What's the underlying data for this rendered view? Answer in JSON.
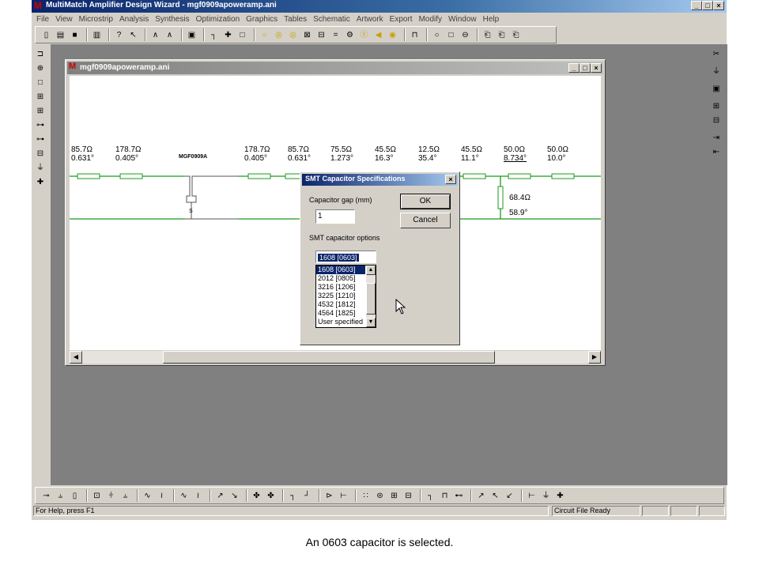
{
  "app": {
    "title": "MultiMatch Amplifier Design Wizard - mgf0909apoweramp.ani",
    "logo": "M",
    "controls": {
      "minimize": "_",
      "maximize": "□",
      "close": "×"
    }
  },
  "menu": [
    "File",
    "View",
    "Microstrip",
    "Analysis",
    "Synthesis",
    "Optimization",
    "Graphics",
    "Tables",
    "Schematic",
    "Artwork",
    "Export",
    "Modify",
    "Window",
    "Help"
  ],
  "child_window": {
    "title": "mgf0909apoweramp.ani",
    "device_label": "MGF0909A",
    "source_pin": "S",
    "elements": [
      {
        "z": "85.7Ω",
        "angle": "0.631°"
      },
      {
        "z": "178.7Ω",
        "angle": "0.405°"
      },
      {
        "z": "178.7Ω",
        "angle": "0.405°"
      },
      {
        "z": "85.7Ω",
        "angle": "0.631°"
      },
      {
        "z": "75.5Ω",
        "angle": "1.273°"
      },
      {
        "z": "45.5Ω",
        "angle": "16.3°"
      },
      {
        "z": "12.5Ω",
        "angle": "35.4°"
      },
      {
        "z": "45.5Ω",
        "angle": "11.1°"
      },
      {
        "z": "50.0Ω",
        "angle": "8.734°"
      },
      {
        "z": "50.0Ω",
        "angle": "10.0°"
      }
    ],
    "shunt": {
      "z": "68.4Ω",
      "angle": "58.9°"
    }
  },
  "dialog": {
    "title": "SMT Capacitor Specifications",
    "gap_label": "Capacitor gap (mm)",
    "gap_value": "1",
    "options_label": "SMT capacitor options",
    "selected": "1608 [0603]",
    "options": [
      "1608 [0603]",
      "2012 [0805]",
      "3216 [1206]",
      "3225 [1210]",
      "4532 [1812]",
      "4564 [1825]",
      "User specified"
    ],
    "ok_label": "OK",
    "cancel_label": "Cancel"
  },
  "status": {
    "help": "For Help, press F1",
    "file": "Circuit File Ready"
  },
  "caption": "An 0603 capacitor is selected."
}
